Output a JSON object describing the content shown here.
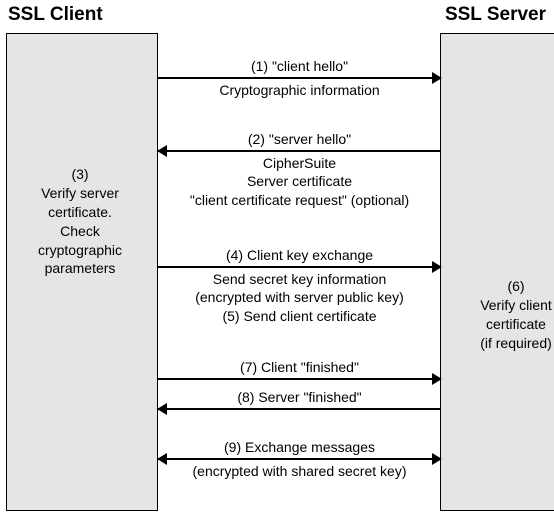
{
  "client_title": "SSL Client",
  "server_title": "SSL Server",
  "msg1": {
    "above": "(1) \"client hello\"",
    "below": "Cryptographic information"
  },
  "msg2": {
    "above": "(2) \"server hello\"",
    "below": "CipherSuite\nServer certificate\n\"client certificate request\" (optional)"
  },
  "note3": "(3)\nVerify server certificate.\nCheck cryptographic parameters",
  "msg4": {
    "above": "(4) Client key exchange",
    "below": "Send secret key information\n(encrypted with server public key)\n(5) Send client certificate"
  },
  "note6": "(6)\nVerify client certificate\n(if required)",
  "msg7": {
    "above": "(7) Client \"finished\""
  },
  "msg8": {
    "above": "(8) Server \"finished\""
  },
  "msg9": {
    "above": "(9) Exchange messages",
    "below": "(encrypted with shared secret key)"
  },
  "chart_data": {
    "type": "sequence",
    "participants": [
      "SSL Client",
      "SSL Server"
    ],
    "messages": [
      {
        "step": 1,
        "from": "SSL Client",
        "to": "SSL Server",
        "label": "\"client hello\"",
        "note": "Cryptographic information"
      },
      {
        "step": 2,
        "from": "SSL Server",
        "to": "SSL Client",
        "label": "\"server hello\"",
        "note": "CipherSuite, Server certificate, \"client certificate request\" (optional)"
      },
      {
        "step": 3,
        "at": "SSL Client",
        "action": "Verify server certificate. Check cryptographic parameters"
      },
      {
        "step": 4,
        "from": "SSL Client",
        "to": "SSL Server",
        "label": "Client key exchange",
        "note": "Send secret key information (encrypted with server public key)"
      },
      {
        "step": 5,
        "from": "SSL Client",
        "to": "SSL Server",
        "label": "Send client certificate"
      },
      {
        "step": 6,
        "at": "SSL Server",
        "action": "Verify client certificate (if required)"
      },
      {
        "step": 7,
        "from": "SSL Client",
        "to": "SSL Server",
        "label": "Client \"finished\""
      },
      {
        "step": 8,
        "from": "SSL Server",
        "to": "SSL Client",
        "label": "Server \"finished\""
      },
      {
        "step": 9,
        "from": "both",
        "to": "both",
        "label": "Exchange messages",
        "note": "(encrypted with shared secret key)"
      }
    ]
  }
}
